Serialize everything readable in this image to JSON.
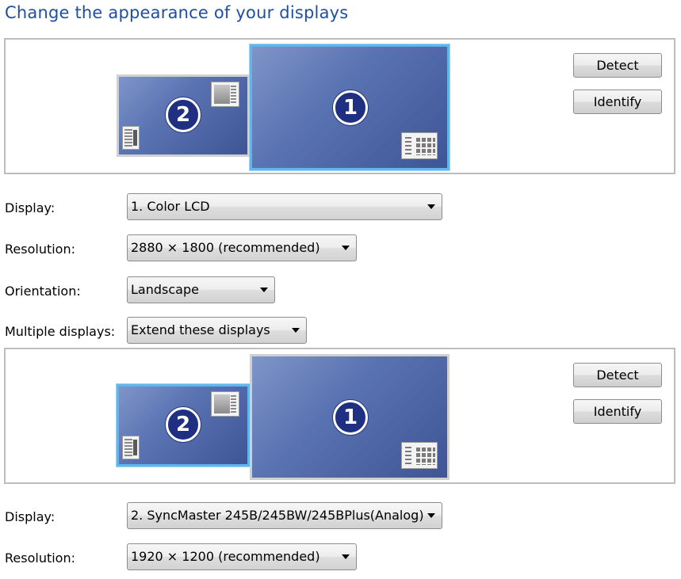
{
  "title": "Change the appearance of your displays",
  "arrangement_top": {
    "monitor_1_number": "1",
    "monitor_2_number": "2",
    "selected_monitor": "1",
    "detect_label": "Detect",
    "identify_label": "Identify"
  },
  "settings_top": {
    "display_label": "Display:",
    "display_value": "1. Color LCD",
    "resolution_label": "Resolution:",
    "resolution_value": "2880 × 1800 (recommended)",
    "orientation_label": "Orientation:",
    "orientation_value": "Landscape",
    "multiple_label": "Multiple displays:",
    "multiple_value": "Extend these displays"
  },
  "arrangement_bottom": {
    "monitor_1_number": "1",
    "monitor_2_number": "2",
    "selected_monitor": "2",
    "detect_label": "Detect",
    "identify_label": "Identify"
  },
  "settings_bottom": {
    "display_label": "Display:",
    "display_value": "2. SyncMaster 245B/245BW/245BPlus(Analog)",
    "resolution_label": "Resolution:",
    "resolution_value": "1920 × 1200 (recommended)"
  },
  "colors": {
    "title": "#1e4fa1",
    "monitor_fill": "#5a73b2",
    "selected_border": "#5fb6ef",
    "badge": "#1f2f82"
  }
}
